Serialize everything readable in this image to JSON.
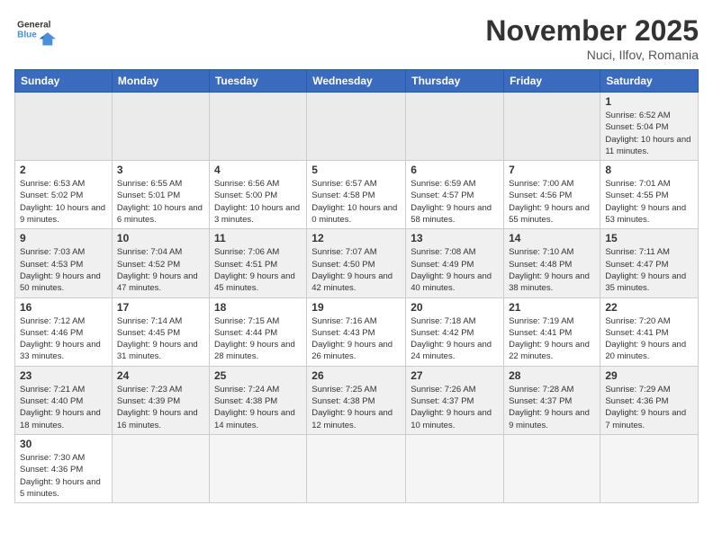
{
  "header": {
    "logo_general": "General",
    "logo_blue": "Blue",
    "month_title": "November 2025",
    "location": "Nuci, Ilfov, Romania"
  },
  "days_of_week": [
    "Sunday",
    "Monday",
    "Tuesday",
    "Wednesday",
    "Thursday",
    "Friday",
    "Saturday"
  ],
  "weeks": [
    [
      {
        "day": "",
        "info": ""
      },
      {
        "day": "",
        "info": ""
      },
      {
        "day": "",
        "info": ""
      },
      {
        "day": "",
        "info": ""
      },
      {
        "day": "",
        "info": ""
      },
      {
        "day": "",
        "info": ""
      },
      {
        "day": "1",
        "info": "Sunrise: 6:52 AM\nSunset: 5:04 PM\nDaylight: 10 hours and 11 minutes."
      }
    ],
    [
      {
        "day": "2",
        "info": "Sunrise: 6:53 AM\nSunset: 5:02 PM\nDaylight: 10 hours and 9 minutes."
      },
      {
        "day": "3",
        "info": "Sunrise: 6:55 AM\nSunset: 5:01 PM\nDaylight: 10 hours and 6 minutes."
      },
      {
        "day": "4",
        "info": "Sunrise: 6:56 AM\nSunset: 5:00 PM\nDaylight: 10 hours and 3 minutes."
      },
      {
        "day": "5",
        "info": "Sunrise: 6:57 AM\nSunset: 4:58 PM\nDaylight: 10 hours and 0 minutes."
      },
      {
        "day": "6",
        "info": "Sunrise: 6:59 AM\nSunset: 4:57 PM\nDaylight: 9 hours and 58 minutes."
      },
      {
        "day": "7",
        "info": "Sunrise: 7:00 AM\nSunset: 4:56 PM\nDaylight: 9 hours and 55 minutes."
      },
      {
        "day": "8",
        "info": "Sunrise: 7:01 AM\nSunset: 4:55 PM\nDaylight: 9 hours and 53 minutes."
      }
    ],
    [
      {
        "day": "9",
        "info": "Sunrise: 7:03 AM\nSunset: 4:53 PM\nDaylight: 9 hours and 50 minutes."
      },
      {
        "day": "10",
        "info": "Sunrise: 7:04 AM\nSunset: 4:52 PM\nDaylight: 9 hours and 47 minutes."
      },
      {
        "day": "11",
        "info": "Sunrise: 7:06 AM\nSunset: 4:51 PM\nDaylight: 9 hours and 45 minutes."
      },
      {
        "day": "12",
        "info": "Sunrise: 7:07 AM\nSunset: 4:50 PM\nDaylight: 9 hours and 42 minutes."
      },
      {
        "day": "13",
        "info": "Sunrise: 7:08 AM\nSunset: 4:49 PM\nDaylight: 9 hours and 40 minutes."
      },
      {
        "day": "14",
        "info": "Sunrise: 7:10 AM\nSunset: 4:48 PM\nDaylight: 9 hours and 38 minutes."
      },
      {
        "day": "15",
        "info": "Sunrise: 7:11 AM\nSunset: 4:47 PM\nDaylight: 9 hours and 35 minutes."
      }
    ],
    [
      {
        "day": "16",
        "info": "Sunrise: 7:12 AM\nSunset: 4:46 PM\nDaylight: 9 hours and 33 minutes."
      },
      {
        "day": "17",
        "info": "Sunrise: 7:14 AM\nSunset: 4:45 PM\nDaylight: 9 hours and 31 minutes."
      },
      {
        "day": "18",
        "info": "Sunrise: 7:15 AM\nSunset: 4:44 PM\nDaylight: 9 hours and 28 minutes."
      },
      {
        "day": "19",
        "info": "Sunrise: 7:16 AM\nSunset: 4:43 PM\nDaylight: 9 hours and 26 minutes."
      },
      {
        "day": "20",
        "info": "Sunrise: 7:18 AM\nSunset: 4:42 PM\nDaylight: 9 hours and 24 minutes."
      },
      {
        "day": "21",
        "info": "Sunrise: 7:19 AM\nSunset: 4:41 PM\nDaylight: 9 hours and 22 minutes."
      },
      {
        "day": "22",
        "info": "Sunrise: 7:20 AM\nSunset: 4:41 PM\nDaylight: 9 hours and 20 minutes."
      }
    ],
    [
      {
        "day": "23",
        "info": "Sunrise: 7:21 AM\nSunset: 4:40 PM\nDaylight: 9 hours and 18 minutes."
      },
      {
        "day": "24",
        "info": "Sunrise: 7:23 AM\nSunset: 4:39 PM\nDaylight: 9 hours and 16 minutes."
      },
      {
        "day": "25",
        "info": "Sunrise: 7:24 AM\nSunset: 4:38 PM\nDaylight: 9 hours and 14 minutes."
      },
      {
        "day": "26",
        "info": "Sunrise: 7:25 AM\nSunset: 4:38 PM\nDaylight: 9 hours and 12 minutes."
      },
      {
        "day": "27",
        "info": "Sunrise: 7:26 AM\nSunset: 4:37 PM\nDaylight: 9 hours and 10 minutes."
      },
      {
        "day": "28",
        "info": "Sunrise: 7:28 AM\nSunset: 4:37 PM\nDaylight: 9 hours and 9 minutes."
      },
      {
        "day": "29",
        "info": "Sunrise: 7:29 AM\nSunset: 4:36 PM\nDaylight: 9 hours and 7 minutes."
      }
    ],
    [
      {
        "day": "30",
        "info": "Sunrise: 7:30 AM\nSunset: 4:36 PM\nDaylight: 9 hours and 5 minutes."
      },
      {
        "day": "",
        "info": ""
      },
      {
        "day": "",
        "info": ""
      },
      {
        "day": "",
        "info": ""
      },
      {
        "day": "",
        "info": ""
      },
      {
        "day": "",
        "info": ""
      },
      {
        "day": "",
        "info": ""
      }
    ]
  ]
}
